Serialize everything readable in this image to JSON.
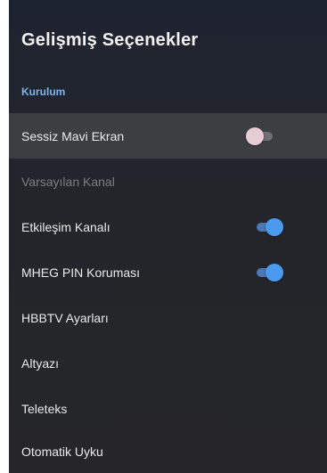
{
  "header": {
    "title": "Gelişmiş Seçenekler",
    "section_label": "Kurulum"
  },
  "items": [
    {
      "label": "Sessiz Mavi Ekran",
      "toggle": "off",
      "selected": true,
      "disabled": false
    },
    {
      "label": "Varsayılan Kanal",
      "toggle": null,
      "selected": false,
      "disabled": true
    },
    {
      "label": "Etkileşim Kanalı",
      "toggle": "on",
      "selected": false,
      "disabled": false
    },
    {
      "label": "MHEG PIN Koruması",
      "toggle": "on",
      "selected": false,
      "disabled": false
    },
    {
      "label": "HBBTV Ayarları",
      "toggle": null,
      "selected": false,
      "disabled": false
    },
    {
      "label": "Altyazı",
      "toggle": null,
      "selected": false,
      "disabled": false
    },
    {
      "label": "Teleteks",
      "toggle": null,
      "selected": false,
      "disabled": false
    },
    {
      "label": "Otomatik Uyku",
      "toggle": null,
      "selected": false,
      "disabled": false
    }
  ],
  "colors": {
    "accent": "#4a9bf0",
    "section": "#7fb2f0",
    "selected_row": "#3d3e42"
  }
}
